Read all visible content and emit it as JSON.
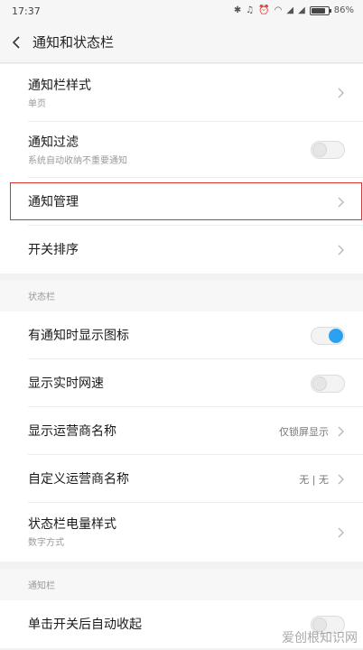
{
  "status_bar": {
    "time": "17:37",
    "icons": [
      "bluetooth-icon",
      "mute-icon",
      "alarm-icon",
      "wifi-icon",
      "signal-icon",
      "signal-icon"
    ],
    "battery_percent": 86,
    "battery_label": "86%"
  },
  "header": {
    "back_icon": "chevron-left-icon",
    "title": "通知和状态栏"
  },
  "group1": {
    "items": [
      {
        "label": "通知栏样式",
        "sub": "单页",
        "control": "chevron"
      },
      {
        "label": "通知过滤",
        "sub": "系统自动收纳不重要通知",
        "control": "toggle",
        "on": false
      },
      {
        "label": "通知管理",
        "control": "chevron",
        "highlighted": true
      },
      {
        "label": "开关排序",
        "control": "chevron"
      }
    ]
  },
  "status_section": {
    "header": "状态栏",
    "items": [
      {
        "label": "有通知时显示图标",
        "control": "toggle",
        "on": true
      },
      {
        "label": "显示实时网速",
        "control": "toggle",
        "on": false
      },
      {
        "label": "显示运营商名称",
        "value": "仅锁屏显示",
        "control": "chevron"
      },
      {
        "label": "自定义运营商名称",
        "value": "无 | 无",
        "control": "chevron"
      },
      {
        "label": "状态栏电量样式",
        "sub": "数字方式",
        "control": "chevron"
      }
    ]
  },
  "notification_section": {
    "header": "通知栏",
    "items": [
      {
        "label": "单击开关后自动收起",
        "control": "toggle",
        "on": false
      }
    ]
  },
  "watermark": "爱创根知识网",
  "colors": {
    "accent": "#2aa2f0",
    "highlight_border": "#d93030"
  }
}
